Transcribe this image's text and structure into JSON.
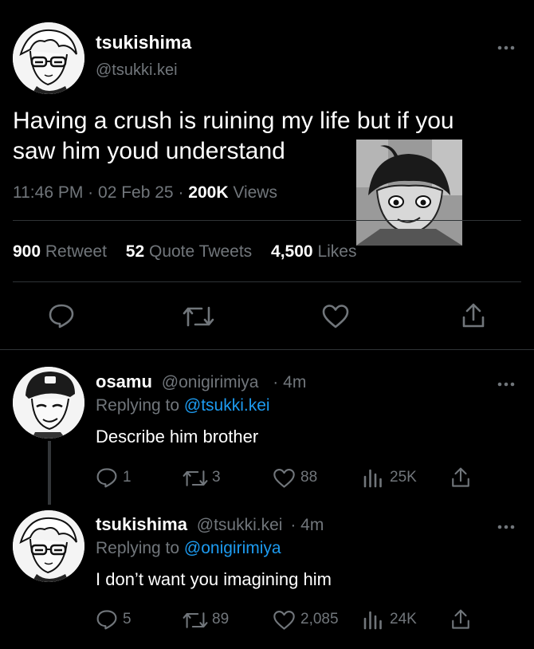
{
  "main_tweet": {
    "display_name": "tsukishima",
    "handle": "@tsukki.kei",
    "text_line1": "Having a crush is ruining my life but if you",
    "text_line2": "saw him youd understand",
    "time": "11:46 PM",
    "date": "02 Feb 25",
    "views_count": "200K",
    "views_label": "Views",
    "retweets_count": "900",
    "retweets_label": "Retweet",
    "quotes_count": "52",
    "quotes_label": "Quote Tweets",
    "likes_count": "4,500",
    "likes_label": "Likes",
    "sep": "·"
  },
  "replies": [
    {
      "display_name": "osamu",
      "handle": "@onigirimiya",
      "age": "4m",
      "replying_prefix": "Replying to",
      "replying_to": "@tsukki.kei",
      "text": "Describe him brother",
      "reply_count": "1",
      "retweet_count": "3",
      "like_count": "88",
      "view_count": "25K"
    },
    {
      "display_name": "tsukishima",
      "handle": "@tsukki.kei",
      "age": "4m",
      "replying_prefix": "Replying to",
      "replying_to": "@onigirimiya",
      "text": "I don’t want you imagining him",
      "reply_count": "5",
      "retweet_count": "89",
      "like_count": "2,085",
      "view_count": "24K"
    }
  ],
  "icons": {
    "reply": "reply-icon",
    "retweet": "retweet-icon",
    "like": "heart-icon",
    "share": "share-icon",
    "views": "views-icon",
    "more": "more-icon"
  },
  "colors": {
    "background": "#000000",
    "text": "#e7e9ea",
    "muted": "#71767b",
    "link": "#1d9bf0",
    "divider": "#2f3336"
  }
}
